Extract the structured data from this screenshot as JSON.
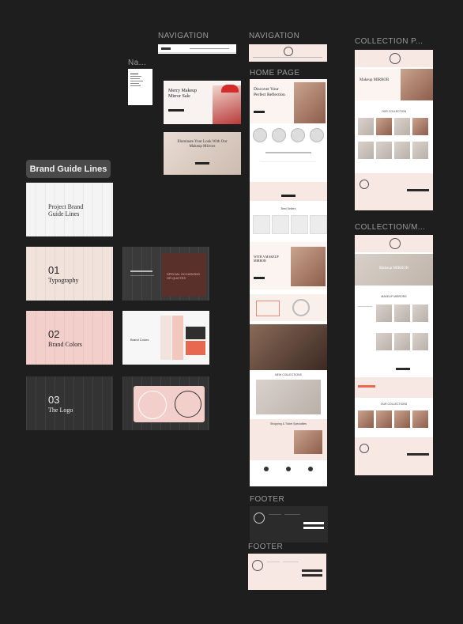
{
  "canvas": {
    "background": "#1e1e1e",
    "label_color": "#9a9a9a"
  },
  "labels": {
    "nav1": "NAVIGATION",
    "nav2": "NAVIGATION",
    "na": "Na...",
    "home": "HOME PAGE",
    "coll1": "COLLECTION P...",
    "coll2": "COLLECTION/M...",
    "footer1": "FOOTER",
    "footer2": "FOOTER"
  },
  "section_chip": "Brand Guide Lines",
  "brand": {
    "cover_title": "Project Brand Guide Lines",
    "typography_num": "01",
    "typography_label": "Typography",
    "colors_num": "02",
    "colors_label": "Brand Colors",
    "logo_num": "03",
    "logo_label": "The Logo",
    "special_text": "SPECIAL OCCASIONS OR QUOTES",
    "brand_colors_title": "Brand Colors",
    "swatches": [
      "#f3e3df",
      "#f4c7bd",
      "#2f2f2f",
      "#e8674f"
    ]
  },
  "banners": {
    "merry": "Merry Makeup Mirror Sale",
    "illuminate": "Illuminate Your Look With Our Makeup Mirrors"
  },
  "home": {
    "hero": "Discover Your Perfect Reflection",
    "best_sellers": "Best Sellers",
    "with_mirror": "WITH A MAKEUP MIRROR",
    "new_collection": "NEW COLLECTIONS",
    "shopping": "Shopping & Ticket Specialties"
  },
  "collection": {
    "title1": "Makeup MIRROR",
    "our_collection": "OUR COLLECTION",
    "title2": "Makeup MIRROR",
    "makeup_mirrors": "MAKEUP MIRRORS",
    "our_collections": "OUR COLLECTIONS"
  },
  "colors": {
    "accent_pink": "#f7e8e4",
    "dark": "#2b2b2b",
    "coral": "#e8674f"
  }
}
